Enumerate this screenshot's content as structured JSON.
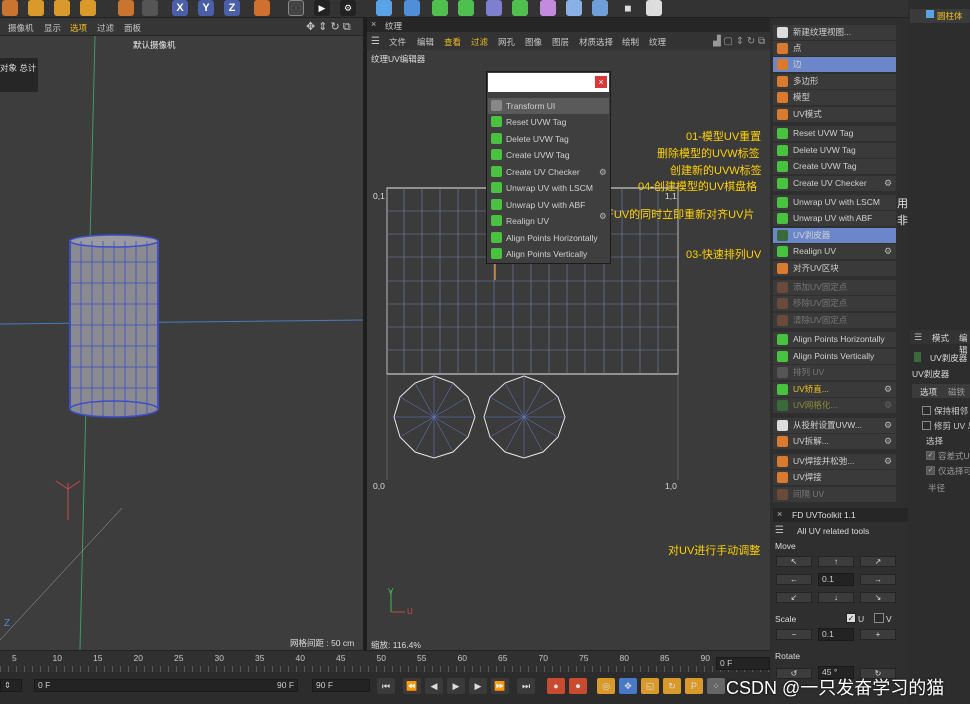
{
  "colors": {
    "accent_yellow": "#ffd200",
    "selection_blue": "#6b87c9",
    "uv_grid_line": "#e8e8e8"
  },
  "toolbar": {
    "icons": [
      "undo-icon",
      "move-icon",
      "scale-icon",
      "rotate-icon",
      "live-select-icon",
      "x-axis-icon",
      "y-axis-icon",
      "z-axis-icon",
      "coord-icon",
      "render-region-icon",
      "render-view-icon",
      "render-settings-icon",
      "cube-icon",
      "pen-icon",
      "subdivision-icon",
      "array-icon",
      "deformer-icon",
      "environment-icon",
      "camera-icon",
      "light-icon"
    ]
  },
  "viewport": {
    "menu": [
      "摄像机",
      "显示",
      "选项",
      "过滤",
      "面板"
    ],
    "camera_label": "默认摄像机",
    "panel_text": "对象 总计",
    "grid_spacing": "网格间距 : 50 cm",
    "axis_z": "Z"
  },
  "texture_panel": {
    "title": "纹理",
    "menu": [
      "文件",
      "编辑",
      "查看",
      "过滤",
      "网孔",
      "图像",
      "图层",
      "材质选择",
      "绘制",
      "纹理"
    ],
    "editor_label": "纹理UV编辑器",
    "corner_tl": "0,1",
    "corner_tr": "1,1",
    "corner_bl": "0,0",
    "corner_br": "1,0",
    "zoom": "缩放: 116.4%",
    "axis_v": "V",
    "axis_u": "U"
  },
  "popup": {
    "items": [
      "Transform UI",
      "Reset UVW Tag",
      "Delete UVW Tag",
      "Create UVW Tag",
      "Create UV Checker",
      "Unwrap UV with LSCM",
      "Unwrap UV with ABF",
      "Realign UV",
      "Align Points Horizontally",
      "Align Points Vertically"
    ]
  },
  "palette": {
    "items": [
      {
        "label": "新建纹理视图...",
        "state": "normal"
      },
      {
        "label": "点",
        "state": "normal"
      },
      {
        "label": "边",
        "state": "selected"
      },
      {
        "label": "多边形",
        "state": "normal"
      },
      {
        "label": "模型",
        "state": "normal"
      },
      {
        "label": "UV模式",
        "state": "normal"
      },
      {
        "label": "Reset UVW Tag",
        "state": "normal"
      },
      {
        "label": "Delete UVW Tag",
        "state": "normal"
      },
      {
        "label": "Create UVW Tag",
        "state": "normal"
      },
      {
        "label": "Create UV Checker",
        "state": "normal"
      },
      {
        "label": "Unwrap UV with LSCM",
        "state": "normal"
      },
      {
        "label": "Unwrap UV with ABF",
        "state": "normal"
      },
      {
        "label": "UV剥皮器",
        "state": "selected"
      },
      {
        "label": "Realign UV",
        "state": "normal"
      },
      {
        "label": "对齐UV区块",
        "state": "normal"
      },
      {
        "label": "添加UV固定点",
        "state": "disabled"
      },
      {
        "label": "移除UV固定点",
        "state": "disabled"
      },
      {
        "label": "清除UV固定点",
        "state": "disabled"
      },
      {
        "label": "Align Points Horizontally",
        "state": "normal"
      },
      {
        "label": "Align Points Vertically",
        "state": "normal"
      },
      {
        "label": "排列 UV",
        "state": "disabled"
      },
      {
        "label": "UV矫直...",
        "state": "normal"
      },
      {
        "label": "UV网格化...",
        "state": "disabled"
      },
      {
        "label": "从投射设置UVW...",
        "state": "normal"
      },
      {
        "label": "UV拆解...",
        "state": "normal"
      },
      {
        "label": "UV焊接并松弛...",
        "state": "normal"
      },
      {
        "label": "UV焊接",
        "state": "normal"
      },
      {
        "label": "间隔 UV",
        "state": "disabled"
      }
    ]
  },
  "annotations": {
    "a1": "01-模型UV重置",
    "a2": "删除模型的UVW标签",
    "a3": "创建新的UVW标签",
    "a4": "04-创建模型的UV棋盘格",
    "a5": "02-展开UV的同时立即重新对齐UV片",
    "a6": "03-快速排列UV",
    "a7": "对UV进行手动调整",
    "w1": "用于硬边面",
    "w2": "非硬边面"
  },
  "uvtoolkit": {
    "title": "FD UVToolkit 1.1",
    "subtitle": "All UV related tools",
    "move_label": "Move",
    "move_value": "0.1",
    "scale_label": "Scale",
    "u_label": "U",
    "v_label": "V",
    "scale_value": "0.1",
    "minus": "−",
    "plus": "+",
    "rotate_label": "Rotate",
    "rotate_value": "45 °"
  },
  "far_right": {
    "object": "圆柱体",
    "tabs": [
      "模式",
      "编辑"
    ],
    "tool_name": "UV剥皮器",
    "section": "UV剥皮器",
    "sub_tabs": [
      "选项",
      "磁铁"
    ],
    "options": [
      {
        "label": "保持相邻",
        "checked": false
      },
      {
        "label": "修剪 UV 岛",
        "checked": false
      }
    ],
    "select_label": "选择",
    "select_options": [
      {
        "label": "容差式UV",
        "checked": true
      },
      {
        "label": "仅选择可见",
        "checked": true
      }
    ],
    "radius_label": "半径"
  },
  "timeline": {
    "ticks": [
      "5",
      "10",
      "15",
      "20",
      "25",
      "30",
      "35",
      "40",
      "45",
      "50",
      "55",
      "60",
      "65",
      "70",
      "75",
      "80",
      "85",
      "90"
    ],
    "frame_field": "0 F",
    "start_field": "0 F",
    "end_field": "90 F",
    "end_field2": "90 F"
  },
  "watermark": "CSDN @一只发奋学习的猫"
}
